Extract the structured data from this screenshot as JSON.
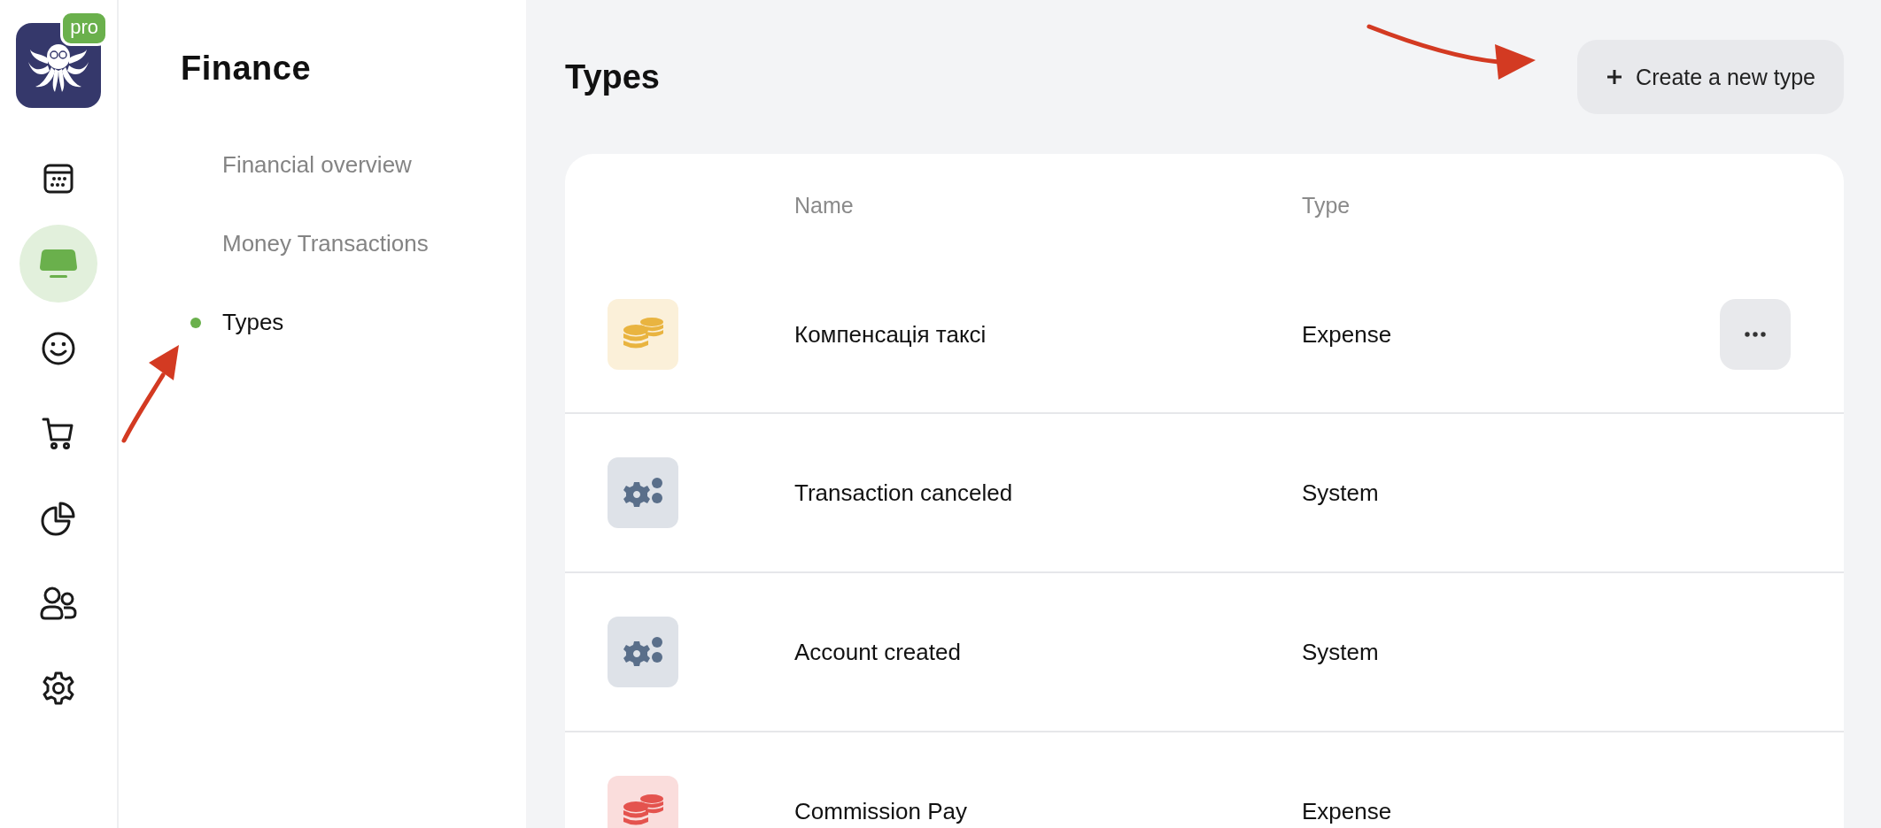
{
  "logo": {
    "badge": "pro"
  },
  "rail": [
    {
      "kind": "calendar",
      "selected": false
    },
    {
      "kind": "wallet",
      "selected": true
    },
    {
      "kind": "smiley",
      "selected": false
    },
    {
      "kind": "cart",
      "selected": false
    },
    {
      "kind": "pie",
      "selected": false
    },
    {
      "kind": "users",
      "selected": false
    },
    {
      "kind": "settings",
      "selected": false
    }
  ],
  "sidebar": {
    "title": "Finance",
    "items": [
      {
        "label": "Financial overview",
        "selected": false
      },
      {
        "label": "Money Transactions",
        "selected": false
      },
      {
        "label": "Types",
        "selected": true
      }
    ]
  },
  "page": {
    "title": "Types",
    "create_button": "Create a new type"
  },
  "table": {
    "columns": [
      "Name",
      "Type"
    ],
    "rows": [
      {
        "kind": "coins",
        "color": "#e9b440",
        "name": "Компенсація таксі",
        "type": "Expense",
        "hovered": true
      },
      {
        "kind": "gears",
        "color": "#5a6f8a",
        "name": "Transaction canceled",
        "type": "System",
        "hovered": false
      },
      {
        "kind": "gears",
        "color": "#5a6f8a",
        "name": "Account created",
        "type": "System",
        "hovered": false
      },
      {
        "kind": "coins",
        "color": "#e4534e",
        "name": "Commission Pay",
        "type": "Expense",
        "hovered": false
      }
    ]
  }
}
